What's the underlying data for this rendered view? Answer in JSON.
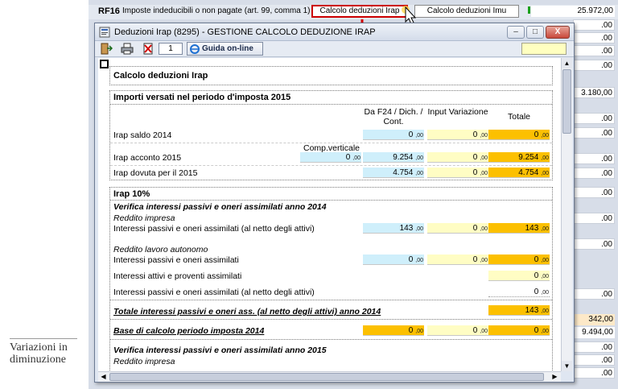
{
  "background": {
    "rf16": {
      "code": "RF16",
      "text": "Imposte indeducibili o non pagate (art. 99, comma 1)",
      "button_irap": "Calcolo deduzioni Irap",
      "button_imu": "Calcolo deduzioni Imu",
      "value": "25.972,00"
    },
    "right_fields": [
      ".00",
      ".00",
      ".00",
      ".00",
      "3.180,00",
      ".00",
      ".00",
      ".00",
      ".00",
      ".00",
      ".00",
      ".00",
      ".00"
    ],
    "value_342": "342,00",
    "value_9494": "9.494,00",
    "bottom_fields": [
      ".00",
      ".00",
      ".00"
    ],
    "side_label": "Variazioni in diminuzione"
  },
  "dialog": {
    "title": "Deduzioni Irap (8295) - GESTIONE CALCOLO DEDUZIONE IRAP",
    "window_buttons": {
      "minimize": "–",
      "maximize": "□",
      "close": "X"
    },
    "toolbar": {
      "page_number": "1",
      "guide_label": "Guida on-line"
    },
    "decimal_suffix": ",00"
  },
  "content": {
    "header_title": "Calcolo deduzioni Irap",
    "importi": {
      "title": "Importi versati nel periodo d'imposta 2015",
      "col_f24": "Da F24 / Dich. / Cont.",
      "col_input": "Input Variazione",
      "col_totale": "Totale",
      "comp_verticale": "Comp.verticale",
      "comp_value": "0",
      "rows": [
        {
          "label": "Irap saldo 2014",
          "f24": "0",
          "input": "0",
          "totale": "0"
        },
        {
          "label": "Irap acconto 2015",
          "f24": "9.254",
          "input": "0",
          "totale": "9.254"
        },
        {
          "label": "Irap dovuta per il 2015",
          "f24": "4.754",
          "input": "0",
          "totale": "4.754"
        }
      ]
    },
    "irap10": {
      "title": "Irap 10%",
      "verifica_2014": "Verifica interessi passivi e oneri assimilati anno 2014",
      "reddito_impresa": "Reddito impresa",
      "row_impresa": {
        "label": "Interessi passivi e oneri assimilati (al netto degli attivi)",
        "f24": "143",
        "input": "0",
        "totale": "143"
      },
      "reddito_lavoro": "Reddito lavoro autonomo",
      "row_lav_passivi": {
        "label": "Interessi passivi e oneri assimilati",
        "f24": "0",
        "input": "0",
        "totale": "0"
      },
      "row_lav_attivi": {
        "label": "Interessi attivi e proventi assimilati",
        "totale": "0"
      },
      "row_lav_netto": {
        "label": "Interessi passivi e oneri assimilati (al netto degli attivi)",
        "totale": "0"
      },
      "totale_2014": {
        "label": "Totale interessi passivi e oneri ass. (al netto degli attivi) anno 2014",
        "totale": "143"
      },
      "base_calcolo": {
        "label": "Base di calcolo periodo imposta 2014",
        "f24": "0",
        "input": "0",
        "totale": "0"
      },
      "verifica_2015": "Verifica interessi passivi e oneri assimilati anno 2015",
      "reddito_impresa_2015": "Reddito impresa"
    }
  },
  "colors": {
    "blue_cell": "#cfeffb",
    "yellow_cell": "#fffdc4",
    "orange_cell": "#fcc000",
    "highlight_border": "#cc0000"
  }
}
